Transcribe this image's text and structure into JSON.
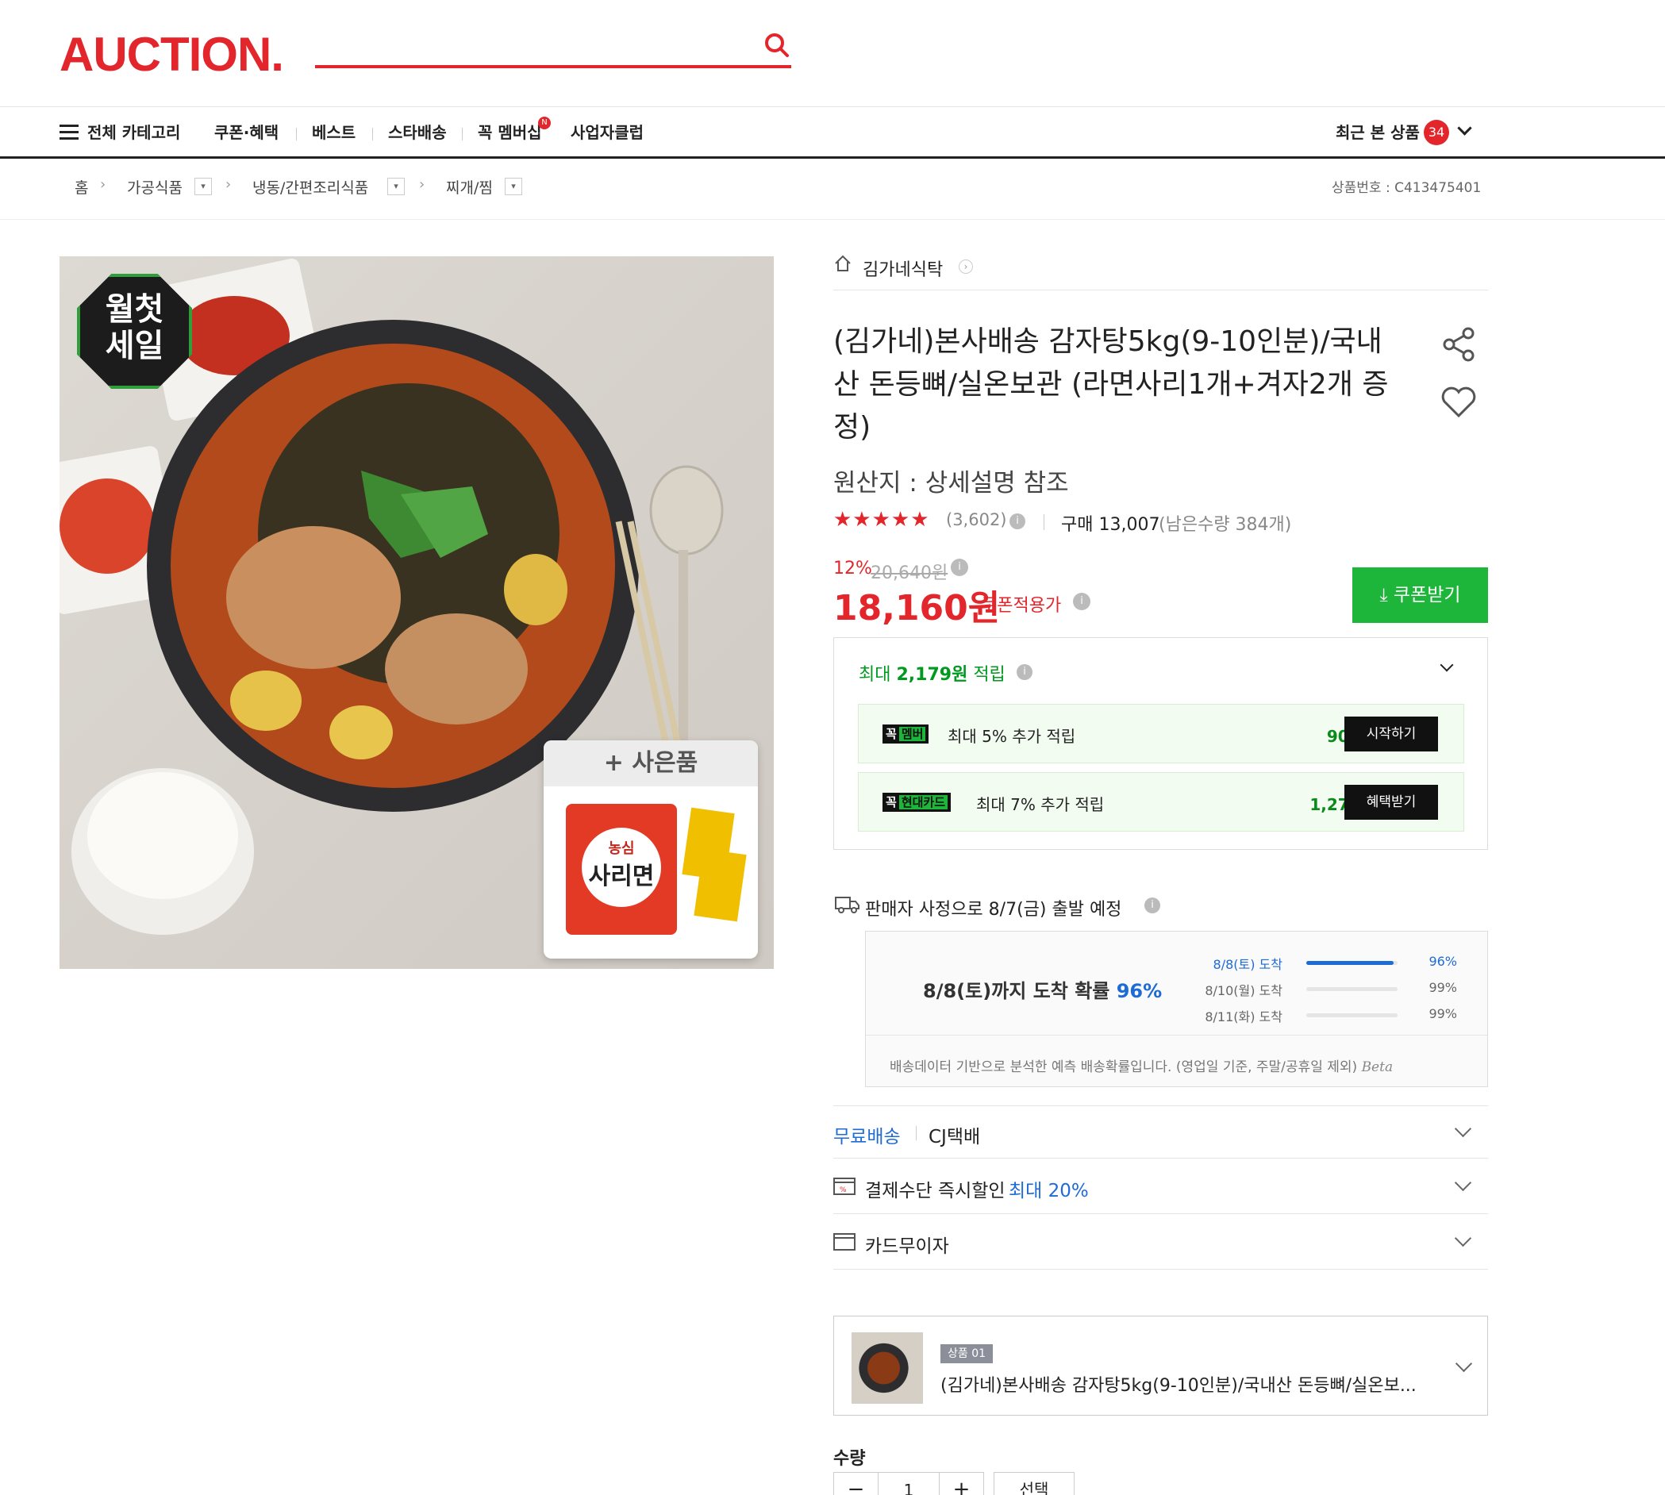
{
  "header": {
    "logo": "AUCTION.",
    "search_placeholder": "",
    "nav": {
      "all_categories": "전체 카테고리",
      "items": [
        "쿠폰·혜택",
        "베스트",
        "스타배송",
        "꼭 멤버십",
        "사업자클럽"
      ],
      "membership_badge": "N",
      "recent": "최근 본 상품",
      "recent_count": "34"
    }
  },
  "breadcrumb": {
    "home": "홈",
    "items": [
      "가공식품",
      "냉동/간편조리식품",
      "찌개/찜"
    ],
    "product_no": "상품번호 : C413475401"
  },
  "image": {
    "badge_line1": "월첫",
    "badge_line2": "세일",
    "gift_label": "+ 사은품",
    "gift_brand": "농심",
    "gift_name": "사리면"
  },
  "product": {
    "seller": "김가네식탁",
    "title": "(김가네)본사배송 감자탕5kg(9-10인분)/국내산 돈등뼈/실온보관 (라면사리1개+겨자2개 증정)",
    "origin": "원산지 : 상세설명 참조",
    "rating_stars": "★★★★★",
    "review_count": "(3,602)",
    "purchase": "구매 13,007",
    "remaining": "(남은수량 384개)",
    "discount": "12%",
    "original_price": "20,640원",
    "price": "18,160원",
    "coupon_price_label": "쿠폰적용가",
    "coupon_button": "쿠폰받기"
  },
  "points": {
    "title_prefix": "최대",
    "amount": "2,179원",
    "title_suffix": "적립",
    "rows": [
      {
        "tag1": "꼭",
        "tag2": "멤버",
        "text": "최대 5% 추가 적립",
        "value": "908원",
        "button": "시작하기"
      },
      {
        "tag1": "꼭",
        "tag2": "현대카드",
        "text": "최대 7% 추가 적립",
        "value": "1,271원",
        "button": "혜택받기"
      }
    ]
  },
  "delivery": {
    "headline": "판매자 사정으로 8/7(금) 출발 예정",
    "prob_label": "8/8(토)까지 도착 확률",
    "prob_value": "96%",
    "rows": [
      {
        "label": "8/8(토) 도착",
        "pct": "96%",
        "fill": 0.96
      },
      {
        "label": "8/10(월) 도착",
        "pct": "99%",
        "fill": 0.0
      },
      {
        "label": "8/11(화) 도착",
        "pct": "99%",
        "fill": 0.0
      }
    ],
    "note": "배송데이터 기반으로 분석한 예측 배송확률입니다. (영업일 기준, 주말/공휴일 제외)",
    "beta": "Beta"
  },
  "options": {
    "shipping_free": "무료배송",
    "courier": "CJ택배",
    "payment_discount": "결제수단 즉시할인",
    "payment_max": "최대 20%",
    "installment": "카드무이자"
  },
  "selection": {
    "tag": "상품 01",
    "name": "(김가네)본사배송 감자탕5kg(9-10인분)/국내산 돈등뼈/실온보...",
    "qty_label": "수량",
    "qty": "1",
    "minus": "−",
    "plus": "+",
    "select": "선택"
  },
  "colors": {
    "brand": "#e3262b",
    "green": "#1db53a",
    "blue": "#1e6bd6"
  }
}
